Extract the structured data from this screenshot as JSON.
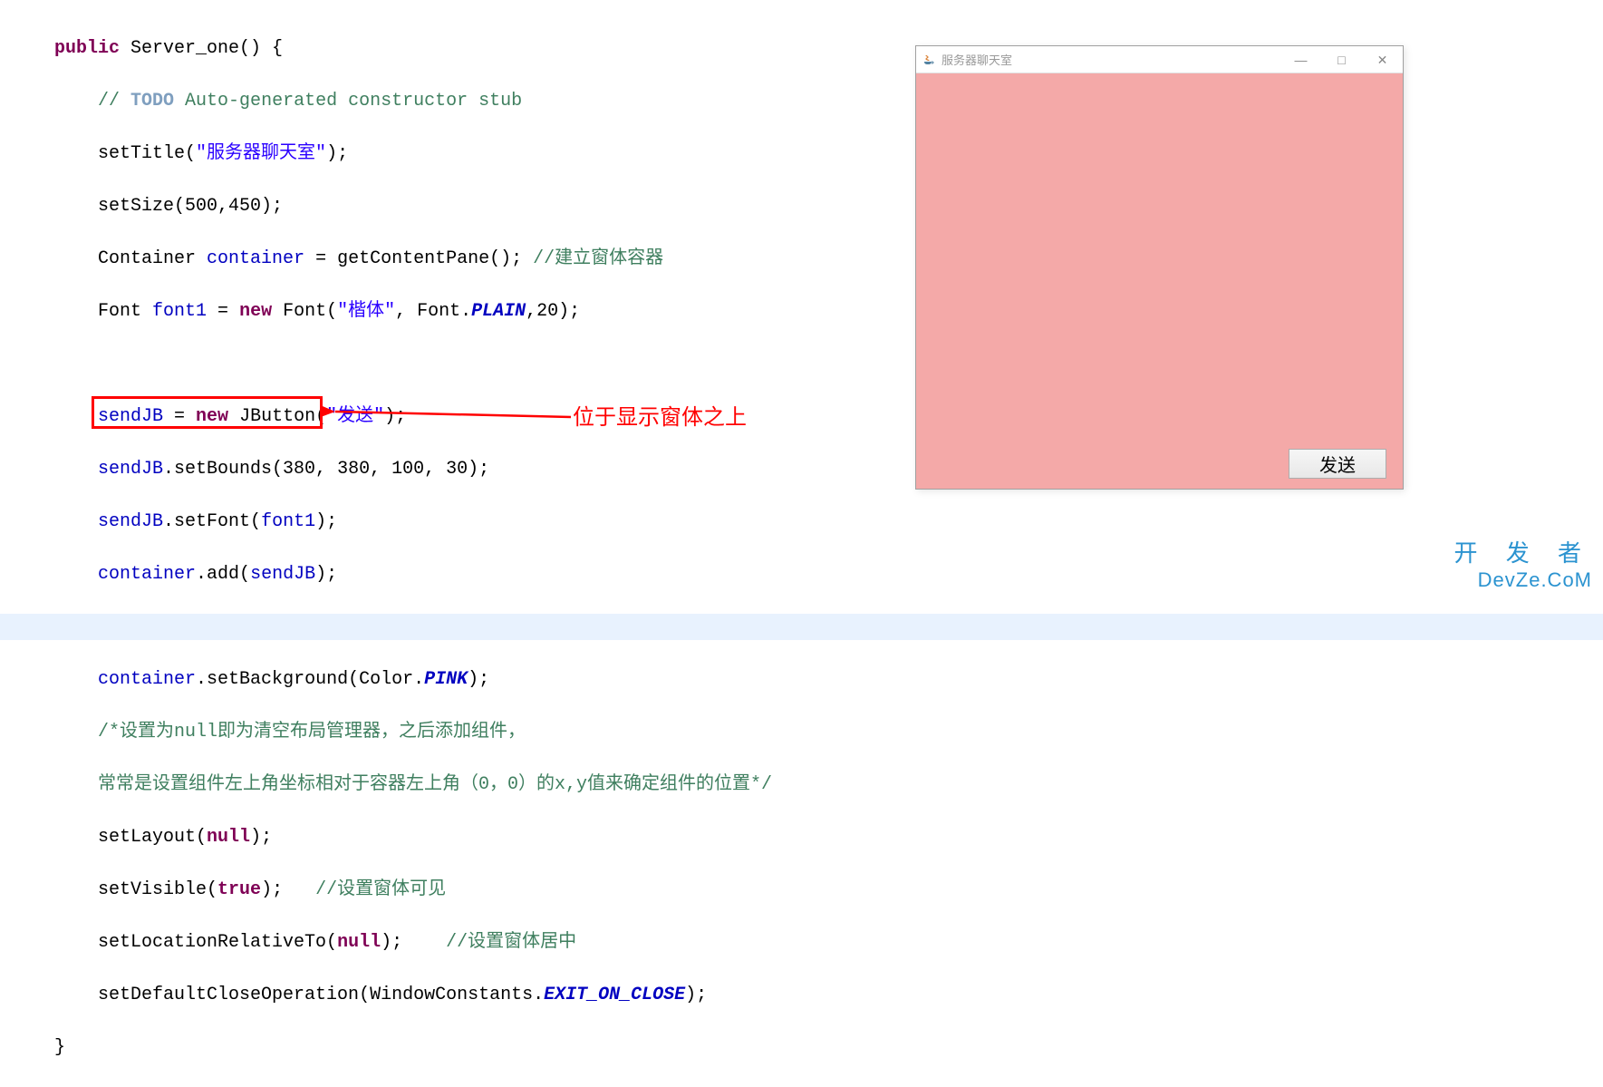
{
  "code": {
    "line1_public": "public",
    "line1_rest": " Server_one() {",
    "line2_slashes": "// ",
    "line2_todo": "TODO",
    "line2_comment": " Auto-generated constructor stub",
    "line3_a": "setTitle(",
    "line3_str": "\"服务器聊天室\"",
    "line3_b": ");",
    "line4": "setSize(500,450);",
    "line5_a": "Container ",
    "line5_var": "container",
    "line5_b": " = getContentPane(); ",
    "line5_comment": "//建立窗体容器",
    "line6_a": "Font ",
    "line6_var": "font1",
    "line6_b": " = ",
    "line6_new": "new",
    "line6_c": " Font(",
    "line6_str": "\"楷体\"",
    "line6_d": ", Font.",
    "line6_const": "PLAIN",
    "line6_e": ",20);",
    "line8_var": "sendJB",
    "line8_a": " = ",
    "line8_new": "new",
    "line8_b": " JButton(",
    "line8_str": "\"发送\"",
    "line8_c": ");",
    "line9_var": "sendJB",
    "line9_rest": ".setBounds(380, 380, 100, 30);",
    "line10_var": "sendJB",
    "line10_a": ".setFont(",
    "line10_arg": "font1",
    "line10_b": ");",
    "line11_var": "container",
    "line11_a": ".add(",
    "line11_arg": "sendJB",
    "line11_b": ");",
    "line13_var": "container",
    "line13_a": ".setBackground(Color.",
    "line13_const": "PINK",
    "line13_b": ");",
    "line14_comment": "/*设置为null即为清空布局管理器，之后添加组件，",
    "line15_comment": "常常是设置组件左上角坐标相对于容器左上角（0，0）的x,y值来确定组件的位置*/",
    "line16_a": "setLayout(",
    "line16_null": "null",
    "line16_b": ");",
    "line17_a": "setVisible(",
    "line17_true": "true",
    "line17_b": ");   ",
    "line17_comment": "//设置窗体可见",
    "line18_a": "setLocationRelativeTo(",
    "line18_null": "null",
    "line18_b": ");    ",
    "line18_comment": "//设置窗体居中",
    "line19_a": "setDefaultCloseOperation(WindowConstants.",
    "line19_const": "EXIT_ON_CLOSE",
    "line19_b": ");",
    "line20": "}"
  },
  "annotation": {
    "label": "位于显示窗体之上"
  },
  "window": {
    "title": "服务器聊天室",
    "minimize": "—",
    "maximize": "□",
    "close": "✕",
    "send_button": "发送"
  },
  "watermark": {
    "top": "开 发 者",
    "bottom": "DevZe.CoM"
  }
}
